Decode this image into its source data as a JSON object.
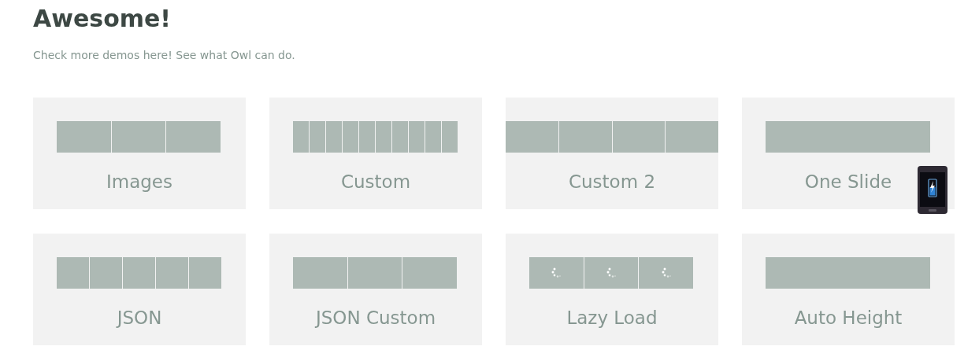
{
  "heading": "Awesome!",
  "subtitle": "Check more demos here! See what Owl can do.",
  "demos": [
    {
      "title": "Images",
      "kind": "three"
    },
    {
      "title": "Custom",
      "kind": "ten"
    },
    {
      "title": "Custom 2",
      "kind": "wide"
    },
    {
      "title": "One Slide",
      "kind": "single"
    },
    {
      "title": "JSON",
      "kind": "five"
    },
    {
      "title": "JSON Custom",
      "kind": "three"
    },
    {
      "title": "Lazy Load",
      "kind": "lazy"
    },
    {
      "title": "Auto Height",
      "kind": "single"
    }
  ]
}
